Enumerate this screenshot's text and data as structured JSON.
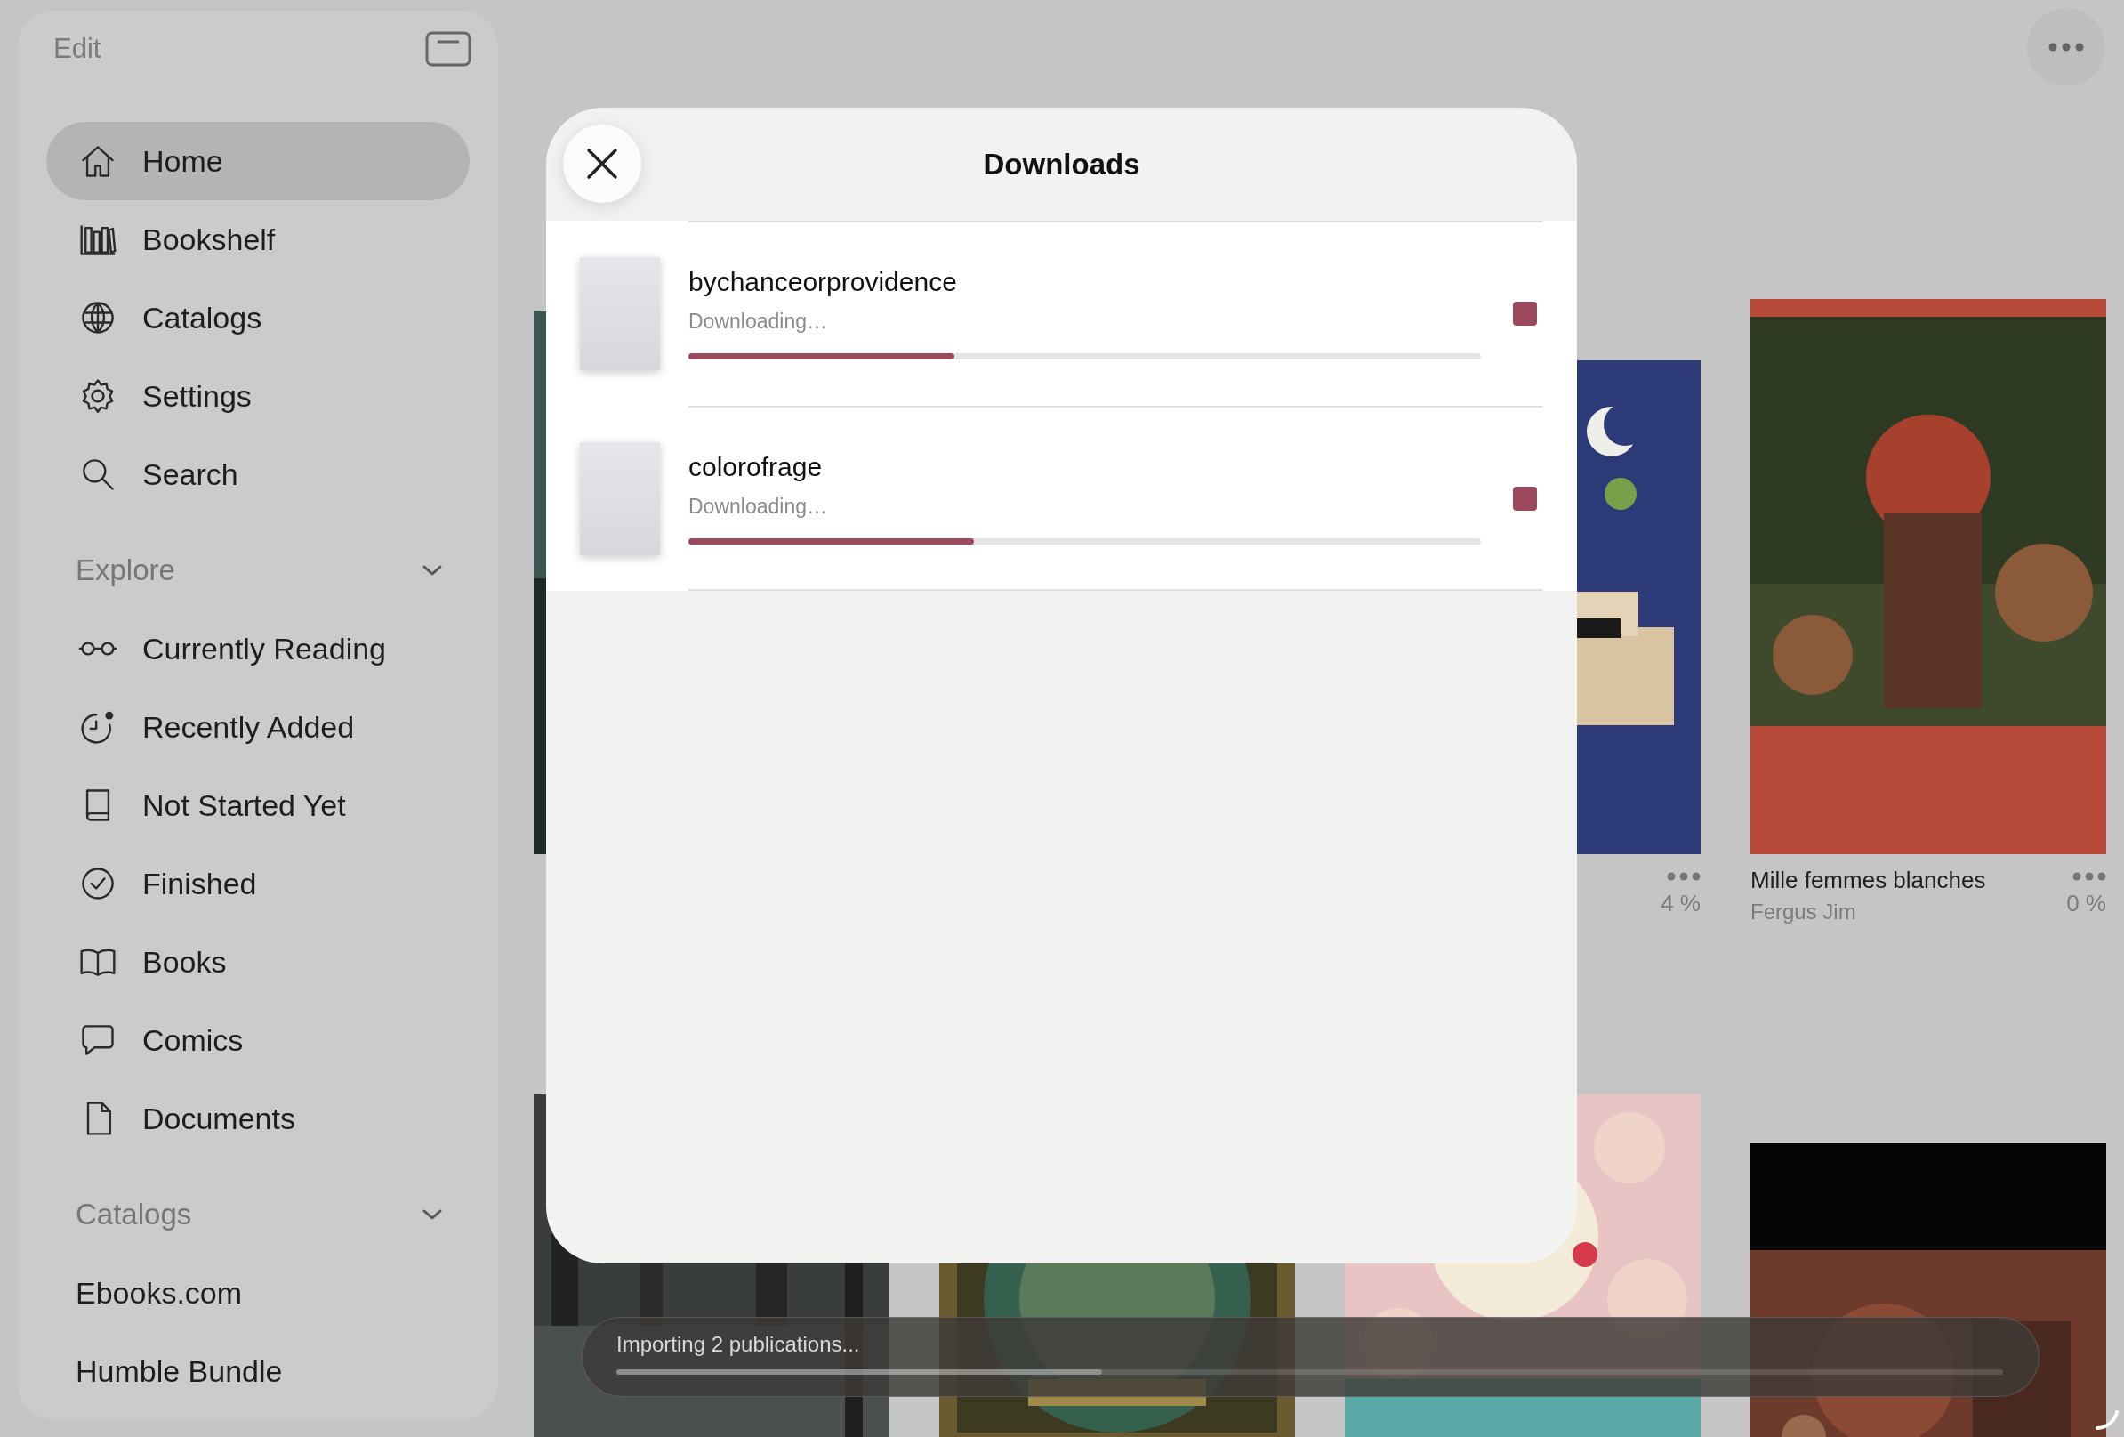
{
  "sidebar": {
    "edit": "Edit",
    "items": [
      {
        "label": "Home",
        "kind": "icon",
        "selected": true
      },
      {
        "label": "Bookshelf",
        "kind": "icon",
        "selected": false
      },
      {
        "label": "Catalogs",
        "kind": "icon",
        "selected": false
      },
      {
        "label": "Settings",
        "kind": "icon",
        "selected": false
      },
      {
        "label": "Search",
        "kind": "icon",
        "selected": false
      }
    ],
    "sections": [
      {
        "title": "Explore",
        "expanded": true,
        "items": [
          {
            "label": "Currently Reading",
            "kind": "icon",
            "selected": false
          },
          {
            "label": "Recently Added",
            "kind": "icon",
            "selected": false
          },
          {
            "label": "Not Started Yet",
            "kind": "icon",
            "selected": false
          },
          {
            "label": "Finished",
            "kind": "icon",
            "selected": false
          },
          {
            "label": "Books",
            "kind": "icon",
            "selected": false
          },
          {
            "label": "Comics",
            "kind": "icon",
            "selected": false
          },
          {
            "label": "Documents",
            "kind": "icon",
            "selected": false
          }
        ]
      },
      {
        "title": "Catalogs",
        "expanded": true,
        "items": [
          {
            "label": "Ebooks.com",
            "kind": "plain",
            "selected": false
          },
          {
            "label": "Humble Bundle",
            "kind": "plain",
            "selected": false
          }
        ]
      }
    ]
  },
  "main": {
    "sections": [
      {
        "books": [
          {
            "kind": "picture"
          },
          {
            "kind": "picture",
            "progress": "4 %"
          },
          {
            "kind": "picture",
            "title": "Mille femmes blanches",
            "author": "Fergus Jim",
            "progress": "0 %"
          }
        ]
      },
      {
        "books": [
          {
            "kind": "picture"
          },
          {
            "kind": "picture"
          },
          {
            "kind": "picture"
          },
          {
            "kind": "picture"
          }
        ]
      }
    ]
  },
  "downloads": {
    "title": "Downloads",
    "items": [
      {
        "name": "bychanceorprovidence",
        "status": "Downloading…",
        "level": 0.336
      },
      {
        "name": "colorofrage",
        "status": "Downloading…",
        "level": 0.36
      }
    ]
  },
  "toast": {
    "text": "Importing 2 publications...",
    "level": 0.35
  }
}
